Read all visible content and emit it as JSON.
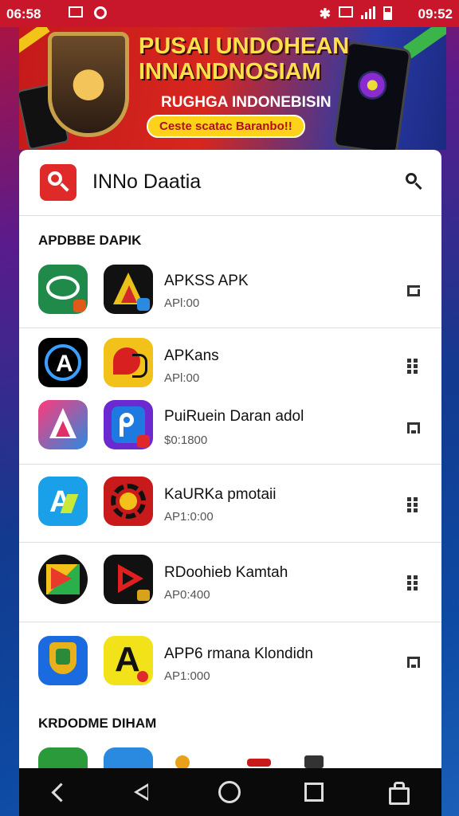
{
  "status_bar": {
    "left_time": "06:58",
    "right_time": "09:52"
  },
  "banner": {
    "title_line1": "PUSAI UNDOHEAN",
    "title_line2": "INNANDNOSIAM",
    "subtitle": "RUGHGA INDONEBISIN",
    "pill": "Ceste scatac Baranbo!!"
  },
  "header": {
    "title": "INNo Daatia"
  },
  "sections": {
    "top": "APDBBE DAPIK",
    "bottom": "KRDODME DIHAM"
  },
  "apps": [
    {
      "name": "APKSS APK",
      "sub": "APl:00",
      "icon_left": "app-icon-emblem",
      "icon_right": "app-icon-triangle-a"
    },
    {
      "name": "APKans",
      "sub": "APl:00",
      "icon_left": "app-icon-a-logo",
      "icon_right": "app-icon-bird"
    },
    {
      "name": "PuiRuein Daran adol",
      "sub": "$0:1800",
      "icon_left": "app-icon-a-pink",
      "icon_right": "app-icon-p-purple"
    },
    {
      "name": "KaURKa pmotaii",
      "sub": "AP1:0:00",
      "icon_left": "app-icon-a-blue",
      "icon_right": "app-icon-gear-red"
    },
    {
      "name": "RDoohieb Kamtah",
      "sub": "AP0:400",
      "icon_left": "app-icon-play-yellow",
      "icon_right": "app-icon-play-red"
    },
    {
      "name": "APP6 rmana Klondidn",
      "sub": "AP1:000",
      "icon_left": "app-icon-shield-blue",
      "icon_right": "app-icon-a-yellow"
    }
  ],
  "colors": {
    "accent": "#e02a2a",
    "status_bar": "#c8162a"
  }
}
